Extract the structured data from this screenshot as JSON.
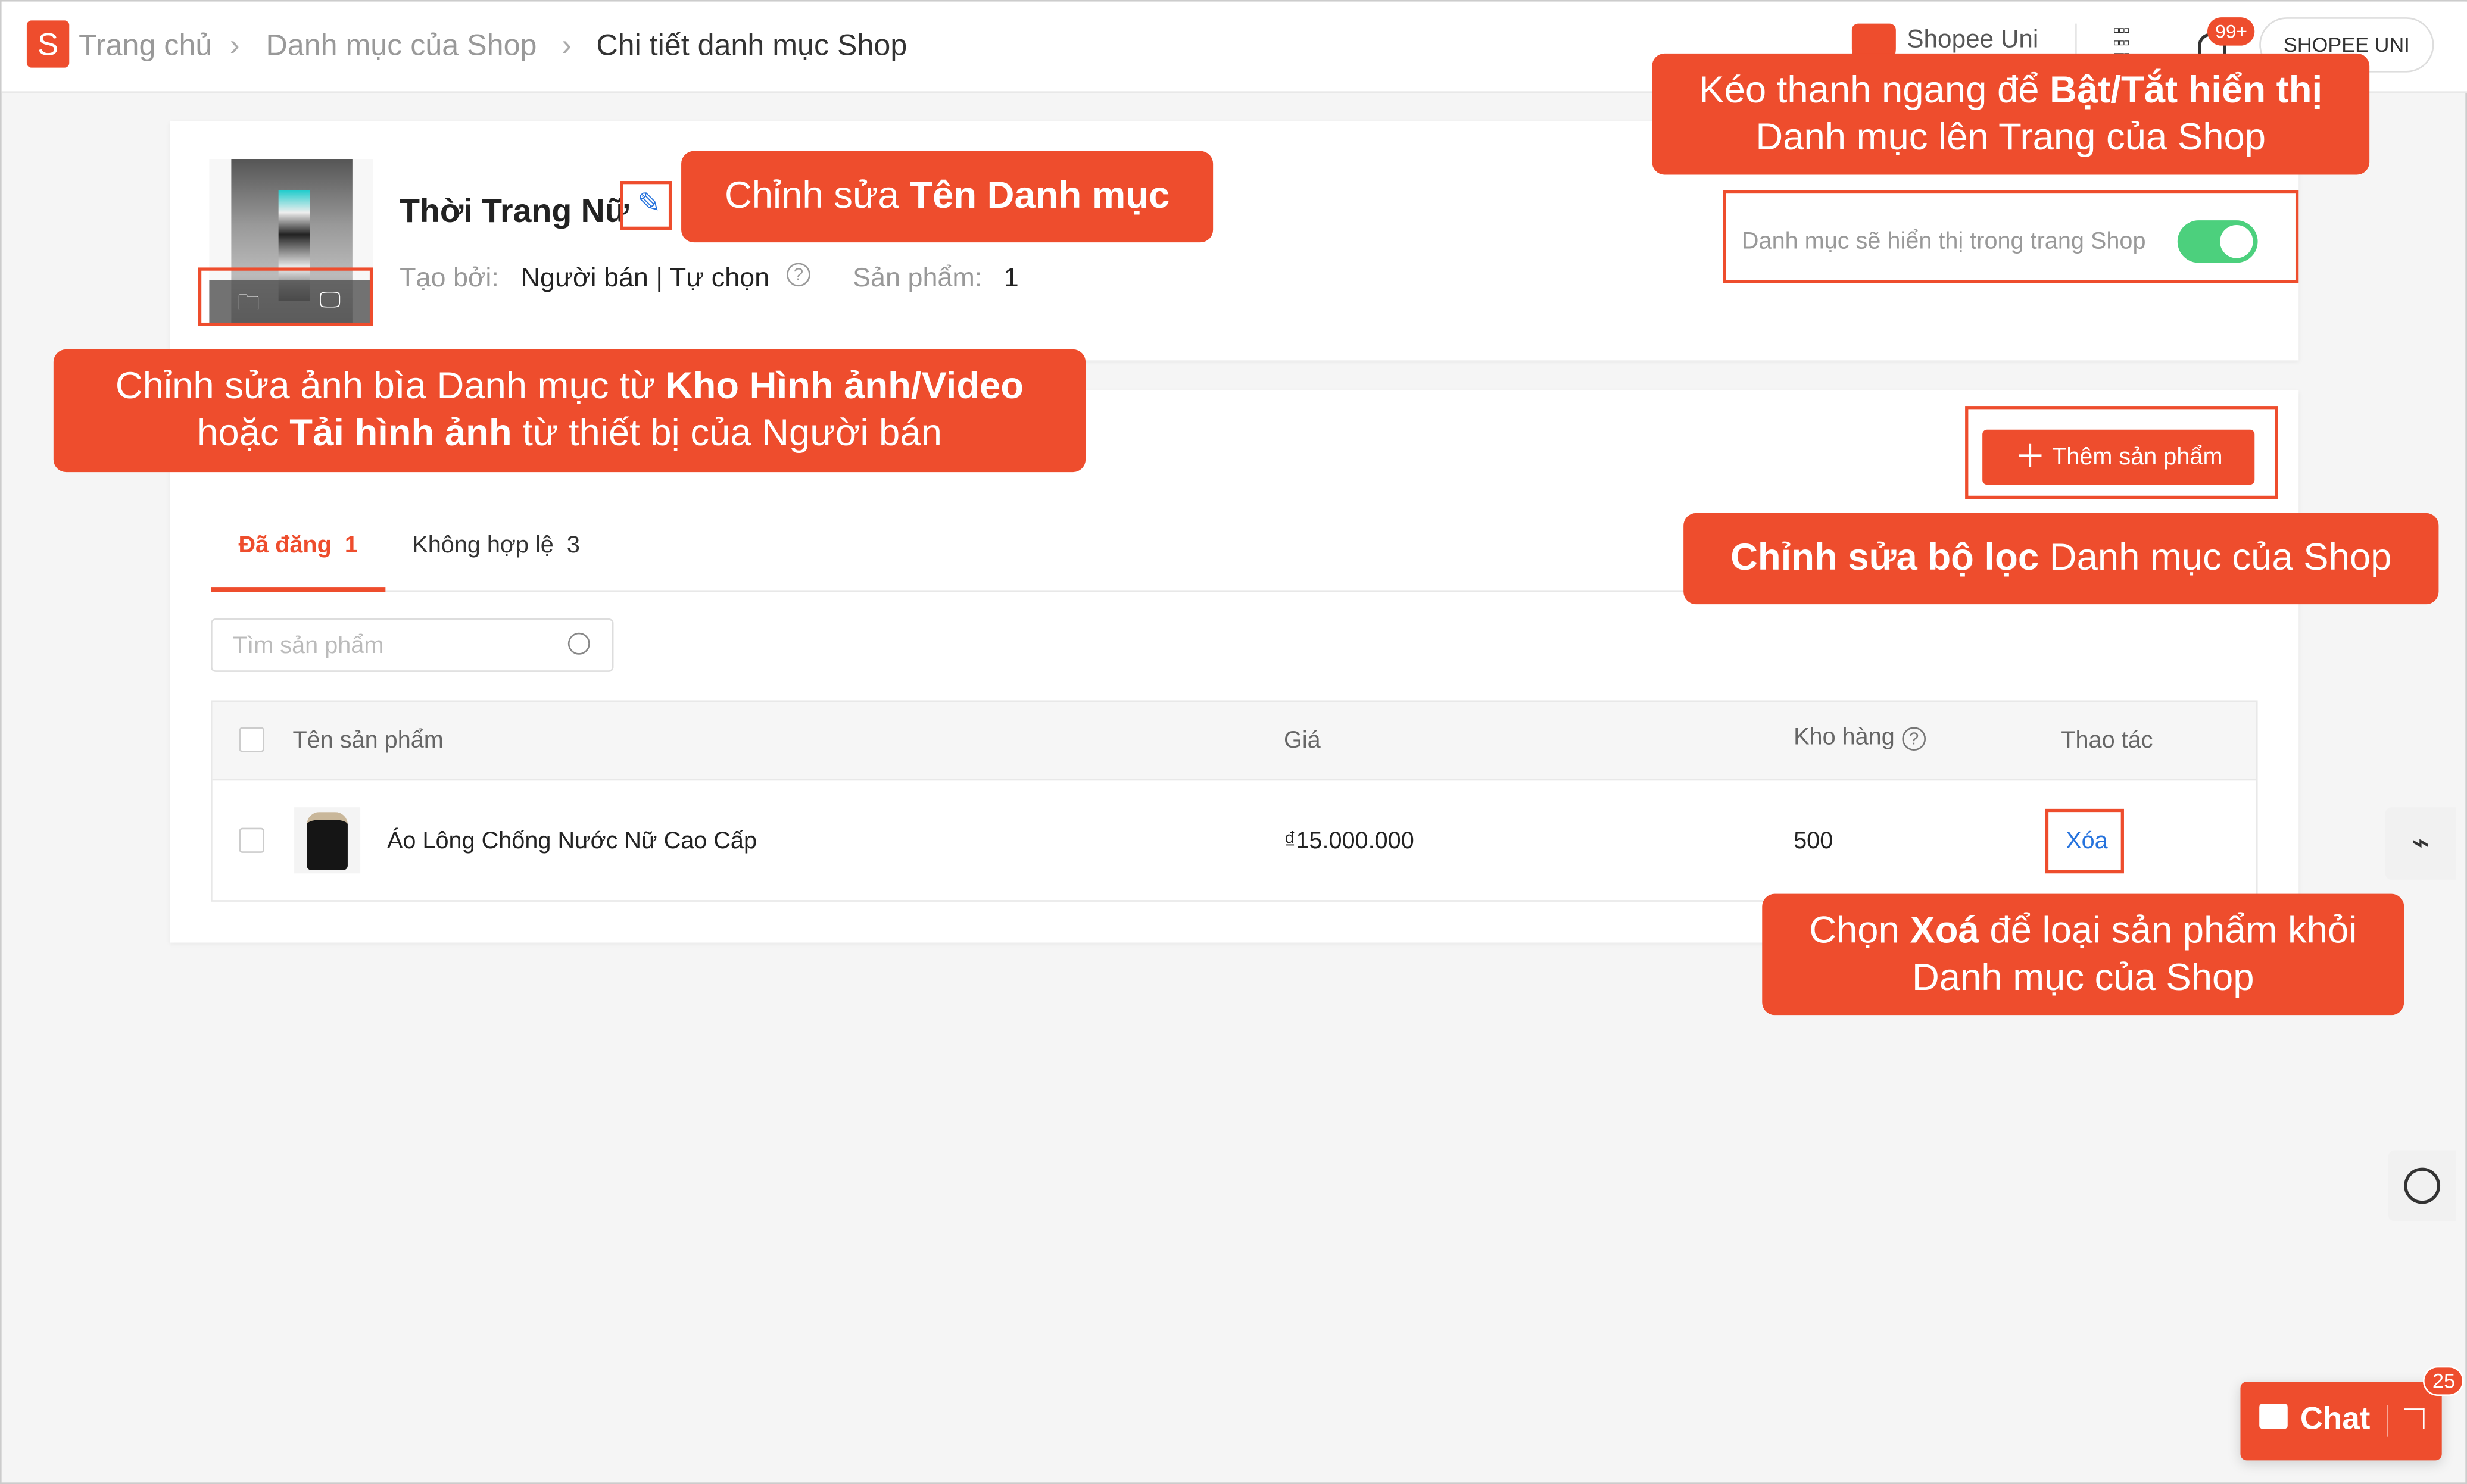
{
  "header": {
    "breadcrumb": [
      "Trang chủ",
      "Danh mục của Shop",
      "Chi tiết danh mục Shop"
    ],
    "shopee_uni": "Shopee Uni",
    "notification_badge": "99+",
    "account_button": "SHOPEE UNI"
  },
  "category": {
    "name": "Thời Trang Nữ",
    "created_by_label": "Tạo bởi:",
    "created_by_value": "Người bán | Tự chọn",
    "products_label": "Sản phẩm:",
    "products_count": "1",
    "visibility_text": "Danh mục sẽ hiển thị trong trang Shop",
    "visibility_on": true
  },
  "add_product_button": "Thêm sản phẩm",
  "tabs": [
    {
      "label": "Đã đăng",
      "count": "1",
      "active": true
    },
    {
      "label": "Không hợp lệ",
      "count": "3",
      "active": false
    }
  ],
  "search": {
    "placeholder": "Tìm sản phẩm"
  },
  "table": {
    "headers": [
      "Tên sản phẩm",
      "Giá",
      "Kho hàng",
      "Thao tác"
    ],
    "rows": [
      {
        "name": "Áo Lông Chống Nước Nữ Cao Cấp",
        "price": "₫15.000.000",
        "stock": "500",
        "action": "Xóa"
      }
    ]
  },
  "callouts": {
    "edit_name": [
      "Chỉnh sửa ",
      "Tên Danh mục"
    ],
    "toggle": [
      "Kéo thanh ngang để ",
      "Bật/Tắt hiển thị",
      "Danh mục lên Trang của Shop"
    ],
    "cover": [
      "Chỉnh sửa ảnh bìa Danh mục từ ",
      "Kho Hình ảnh/Video",
      "hoặc ",
      "Tải hình ảnh",
      " từ thiết bị của Người bán"
    ],
    "filter": [
      "Chỉnh sửa bộ lọc",
      " Danh mục của Shop"
    ],
    "delete": [
      "Chọn ",
      "Xoá",
      " để loại sản phẩm khỏi",
      "Danh mục của Shop"
    ]
  },
  "chat": {
    "label": "Chat",
    "badge": "25"
  },
  "colors": {
    "brand": "#ee4d2d",
    "toggle": "#4cd07d",
    "link": "#2673dd"
  }
}
